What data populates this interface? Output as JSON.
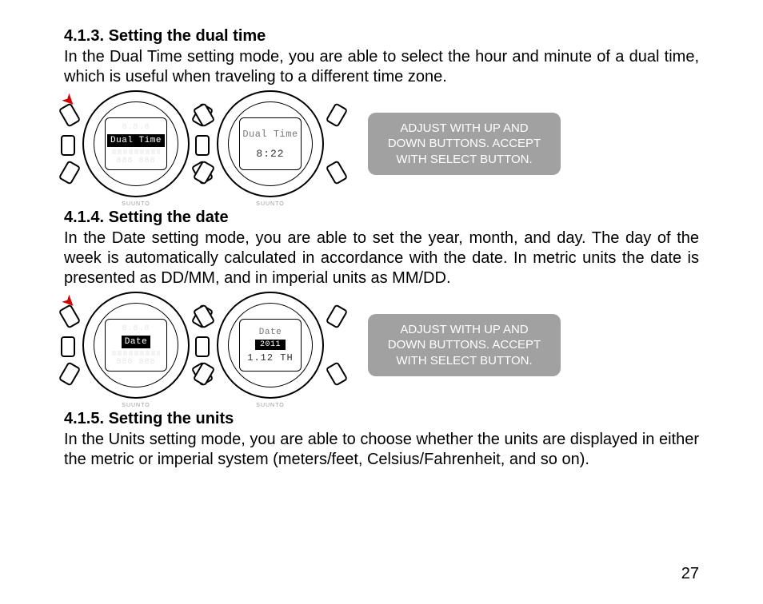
{
  "page_number": "27",
  "sections": {
    "s1": {
      "heading": "4.1.3. Setting the dual time",
      "text": "In the Dual Time setting mode, you are able to select the hour and minute of a dual time, which is useful when traveling to a different time zone.",
      "watch1": {
        "label": "Dual Time"
      },
      "watch2": {
        "label": "Dual Time",
        "value": "8:22"
      },
      "callout": "ADJUST WITH UP AND DOWN BUTTONS.  ACCEPT WITH SELECT BUTTON."
    },
    "s2": {
      "heading": "4.1.4. Setting the date",
      "text": "In the Date setting mode, you are able to set the year, month, and day. The day of the week is automatically calculated in accordance with the date. In metric units the date is presented as DD/MM, and in imperial units as MM/DD.",
      "watch1": {
        "label": "Date"
      },
      "watch2": {
        "label": "Date",
        "year": "2011",
        "value": "1.12 TH"
      },
      "callout": "ADJUST WITH UP AND DOWN BUTTONS.  ACCEPT WITH SELECT BUTTON."
    },
    "s3": {
      "heading": "4.1.5. Setting the units",
      "text": "In the Units setting mode, you are able to choose whether the units are displayed in either the metric or imperial system (meters/feet, Celsius/Fahrenheit, and so on)."
    }
  },
  "brand": "SUUNTO"
}
